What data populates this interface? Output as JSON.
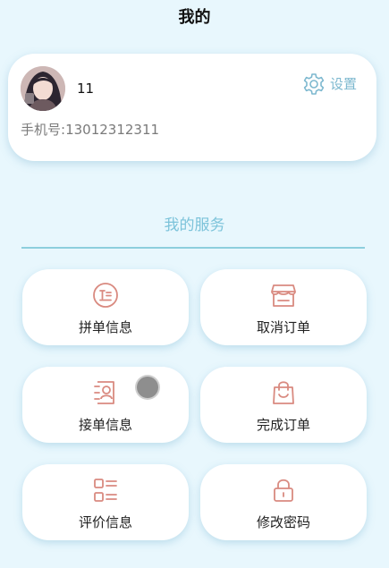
{
  "header": {
    "title": "我的"
  },
  "profile": {
    "username": "11",
    "settings_label": "设置",
    "phone_label": "手机号:",
    "phone_number": "13012312311"
  },
  "services": {
    "title": "我的服务",
    "items": [
      {
        "label": "拼单信息",
        "icon": "text-bubble-icon"
      },
      {
        "label": "取消订单",
        "icon": "storefront-icon"
      },
      {
        "label": "接单信息",
        "icon": "user-card-icon"
      },
      {
        "label": "完成订单",
        "icon": "shopping-bag-icon"
      },
      {
        "label": "评价信息",
        "icon": "list-icon"
      },
      {
        "label": "修改密码",
        "icon": "lock-icon"
      }
    ]
  },
  "colors": {
    "background": "#e8f7fd",
    "accent": "#7cc3da",
    "icon": "#d98a80"
  }
}
